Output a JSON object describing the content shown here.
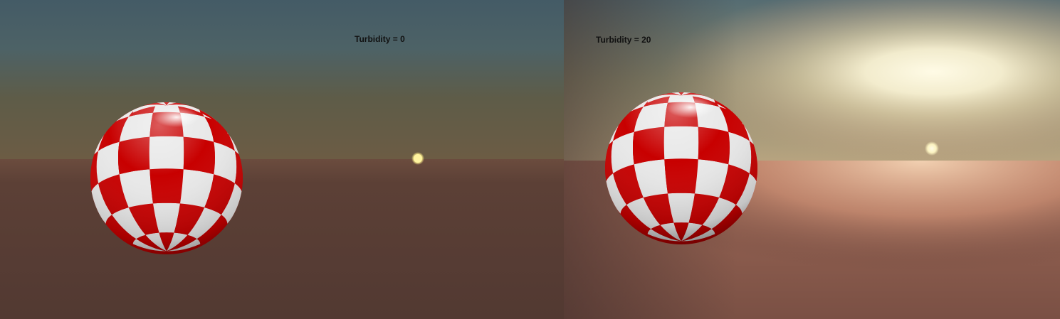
{
  "panels": [
    {
      "label": "Turbidity = 0"
    },
    {
      "label": "Turbidity = 20"
    }
  ],
  "colors": {
    "checker_red": "#c80000",
    "checker_white": "#e8e8e8",
    "sun_left": "#fff6a0",
    "sun_right": "#fffbe0"
  }
}
